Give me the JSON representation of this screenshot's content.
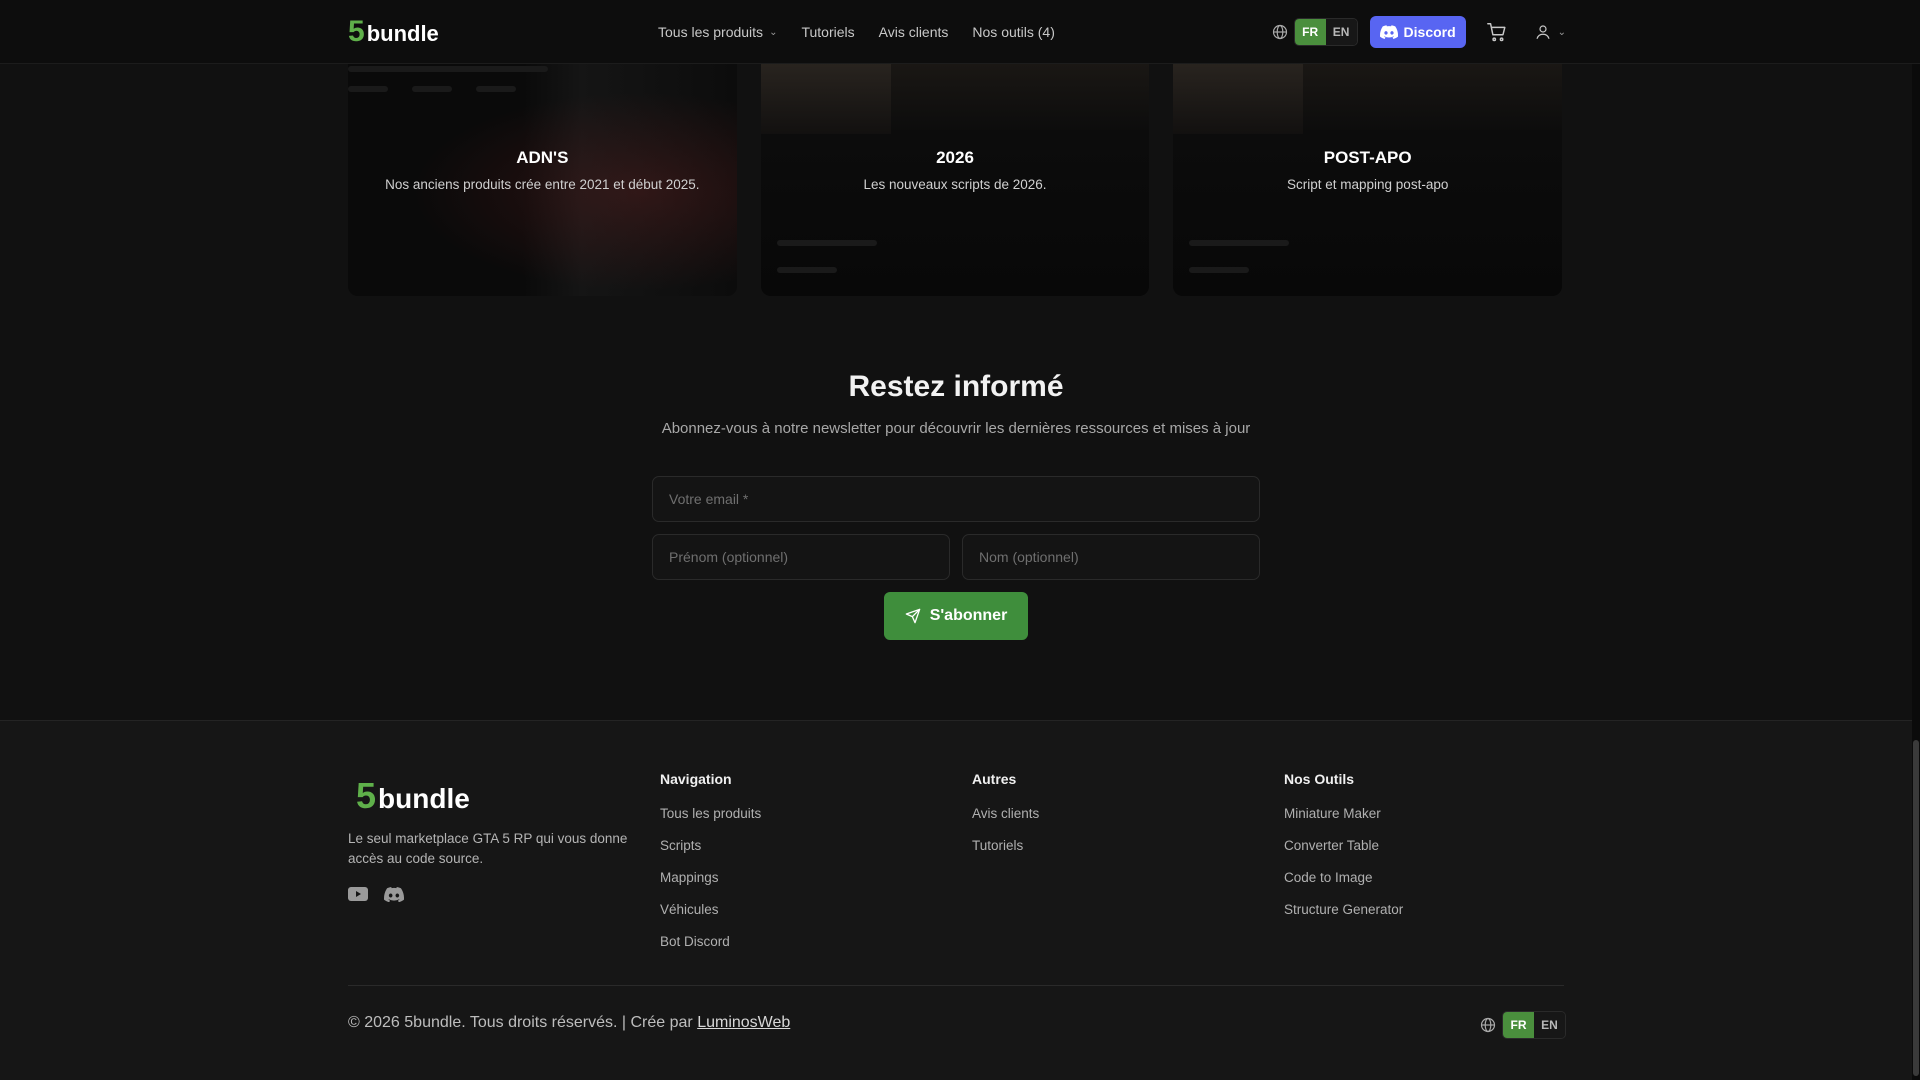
{
  "colors": {
    "brand_green": "#5fb04a",
    "accent_button": "#3f8e3c",
    "discord": "#5865f2",
    "background": "#111111",
    "footer_bg": "#161616"
  },
  "header": {
    "logo": {
      "digit": "5",
      "word": "bundle"
    },
    "nav": [
      {
        "label": "Tous les produits",
        "has_dropdown": true
      },
      {
        "label": "Tutoriels"
      },
      {
        "label": "Avis clients"
      },
      {
        "label": "Nos outils (4)"
      }
    ],
    "lang": {
      "fr": "FR",
      "en": "EN",
      "active": "FR"
    },
    "discord_label": "Discord",
    "icons": [
      "globe-icon",
      "discord-icon",
      "cart-icon",
      "user-icon",
      "chevron-down-icon"
    ]
  },
  "categories": [
    {
      "title": "ADN'S",
      "desc": "Nos anciens produits crée entre 2021 et début 2025."
    },
    {
      "title": "2026",
      "desc": "Les nouveaux scripts de 2026."
    },
    {
      "title": "POST-APO",
      "desc": "Script et mapping post-apo"
    }
  ],
  "newsletter": {
    "title": "Restez informé",
    "subtitle": "Abonnez-vous à notre newsletter pour découvrir les dernières ressources et mises à jour",
    "email_placeholder": "Votre email *",
    "firstname_placeholder": "Prénom (optionnel)",
    "lastname_placeholder": "Nom (optionnel)",
    "submit_label": "S'abonner",
    "submit_icon": "send-icon"
  },
  "footer": {
    "logo": {
      "digit": "5",
      "word": "bundle"
    },
    "tagline": "Le seul marketplace GTA 5 RP qui vous donne accès au code source.",
    "social": [
      "youtube-icon",
      "discord-icon"
    ],
    "columns": [
      {
        "title": "Navigation",
        "links": [
          "Tous les produits",
          "Scripts",
          "Mappings",
          "Véhicules",
          "Bot Discord"
        ]
      },
      {
        "title": "Autres",
        "links": [
          "Avis clients",
          "Tutoriels"
        ]
      },
      {
        "title": "Nos Outils",
        "links": [
          "Miniature Maker",
          "Converter Table",
          "Code to Image",
          "Structure Generator"
        ]
      }
    ],
    "copyright": "© 2026 5bundle. Tous droits réservés. | Crée par",
    "credit_link": "LuminosWeb",
    "lang": {
      "fr": "FR",
      "en": "EN",
      "active": "FR"
    }
  }
}
